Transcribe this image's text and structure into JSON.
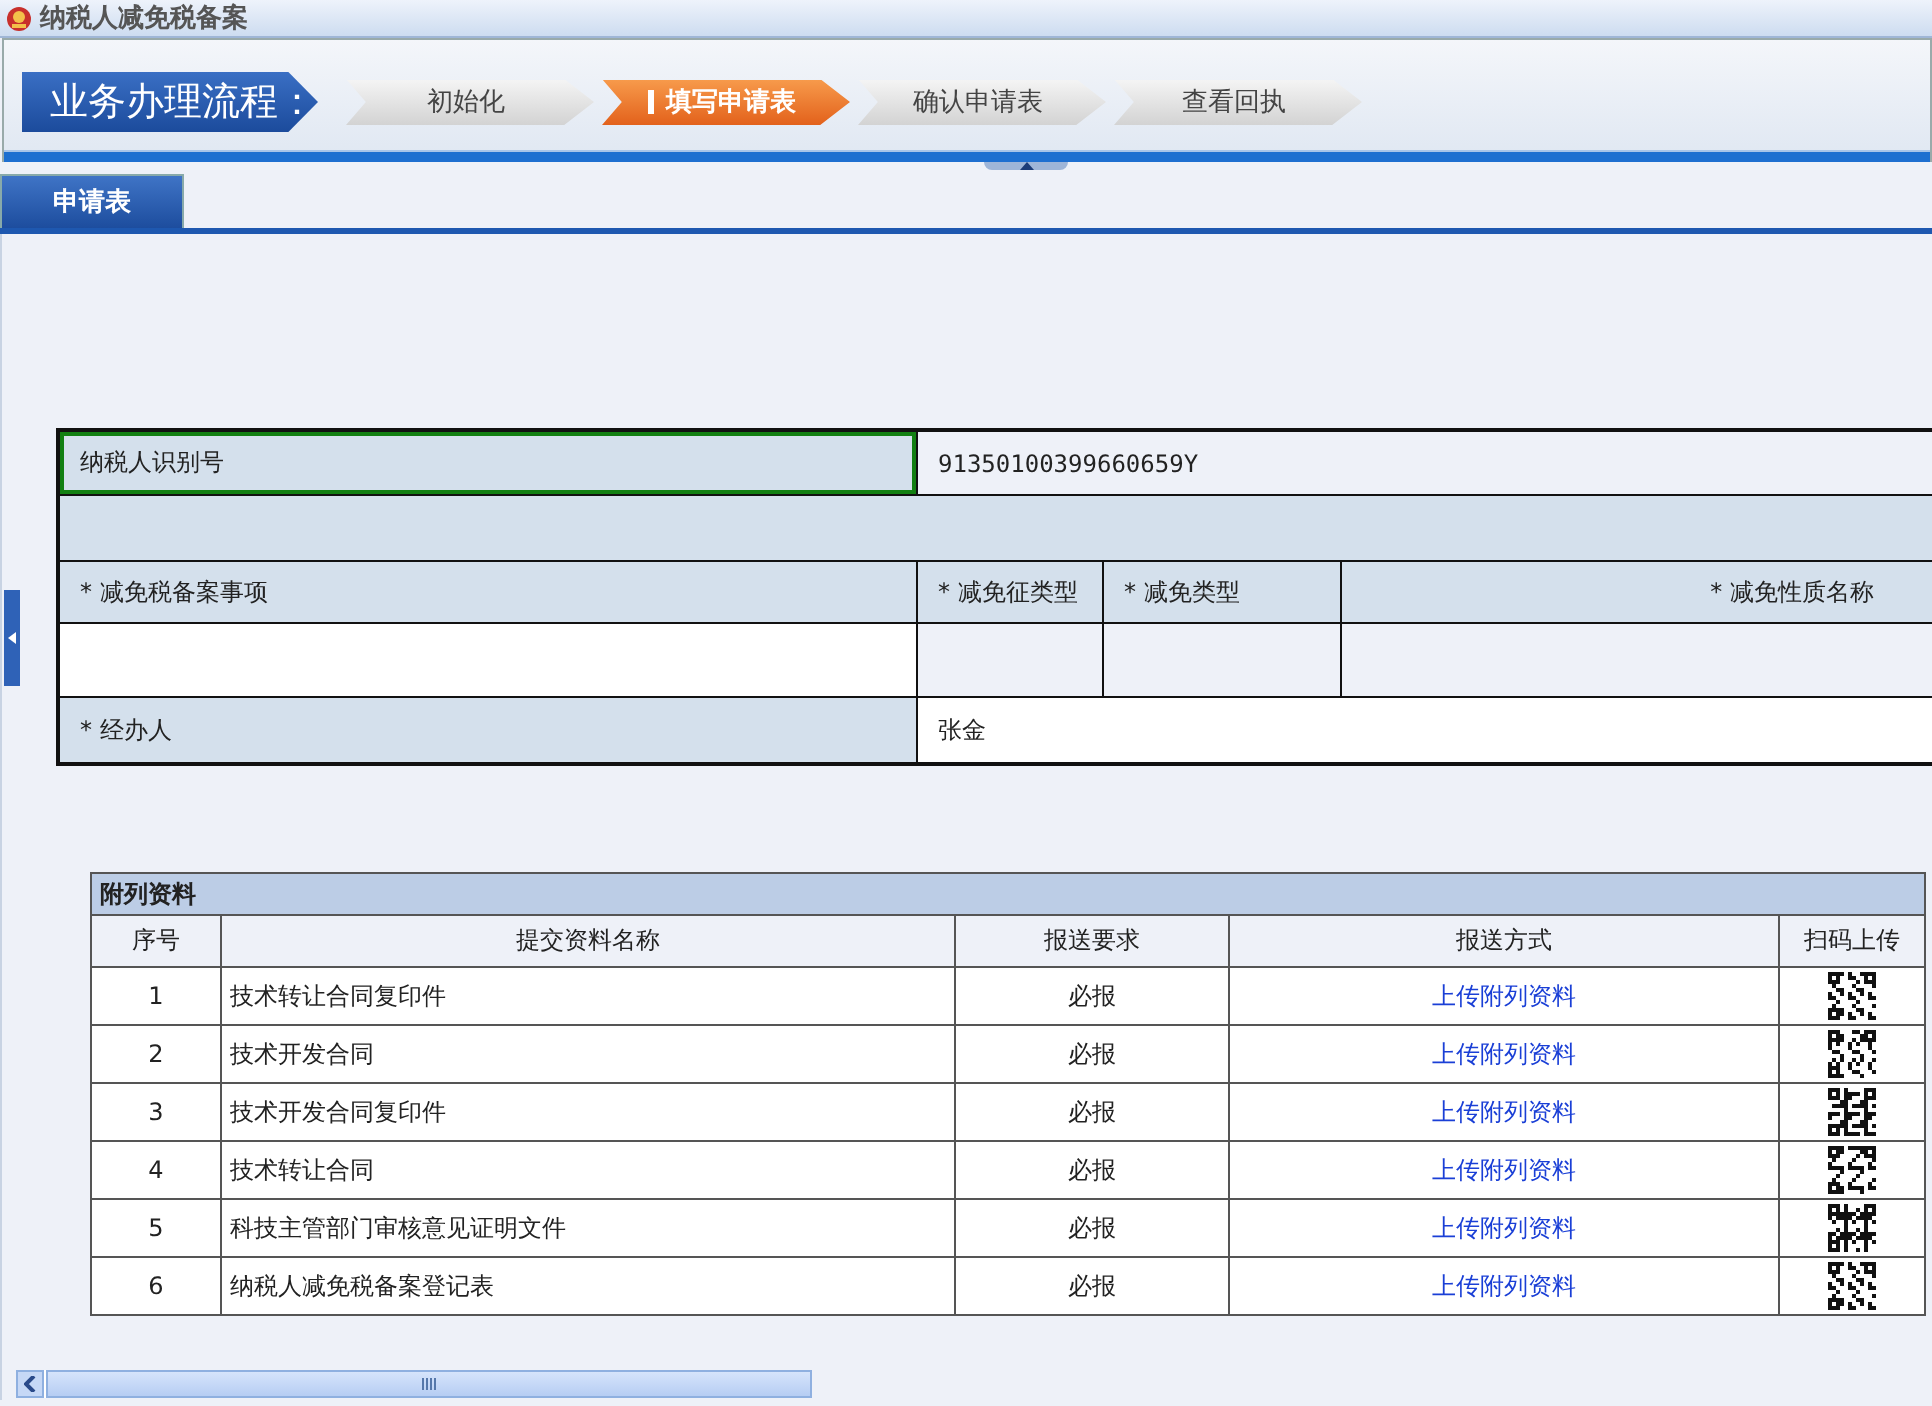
{
  "window": {
    "title": "纳税人减免税备案"
  },
  "process": {
    "label": "业务办理流程：",
    "steps": [
      {
        "label": "初始化",
        "selected": false
      },
      {
        "label": "填写申请表",
        "selected": true
      },
      {
        "label": "确认申请表",
        "selected": false
      },
      {
        "label": "查看回执",
        "selected": false
      }
    ]
  },
  "tabs": [
    {
      "label": "申请表",
      "selected": true
    }
  ],
  "form": {
    "taxpayer_id": {
      "label": "纳税人识别号",
      "value": "91350100399660659Y",
      "focused": true
    },
    "headers": [
      "* 减免税备案事项",
      "* 减免征类型",
      "* 减免类型",
      "* 减免性质名称"
    ],
    "agent": {
      "label": "* 经办人",
      "value": "张金"
    }
  },
  "attachments": {
    "title": "附列资料",
    "columns": [
      "序号",
      "提交资料名称",
      "报送要求",
      "报送方式",
      "扫码上传"
    ],
    "rows": [
      {
        "index": "1",
        "name": "技术转让合同复印件",
        "requirement": "必报",
        "method": "上传附列资料"
      },
      {
        "index": "2",
        "name": "技术开发合同",
        "requirement": "必报",
        "method": "上传附列资料"
      },
      {
        "index": "3",
        "name": "技术开发合同复印件",
        "requirement": "必报",
        "method": "上传附列资料"
      },
      {
        "index": "4",
        "name": "技术转让合同",
        "requirement": "必报",
        "method": "上传附列资料"
      },
      {
        "index": "5",
        "name": "科技主管部门审核意见证明文件",
        "requirement": "必报",
        "method": "上传附列资料"
      },
      {
        "index": "6",
        "name": "纳税人减免税备案登记表",
        "requirement": "必报",
        "method": "上传附列资料"
      }
    ]
  }
}
